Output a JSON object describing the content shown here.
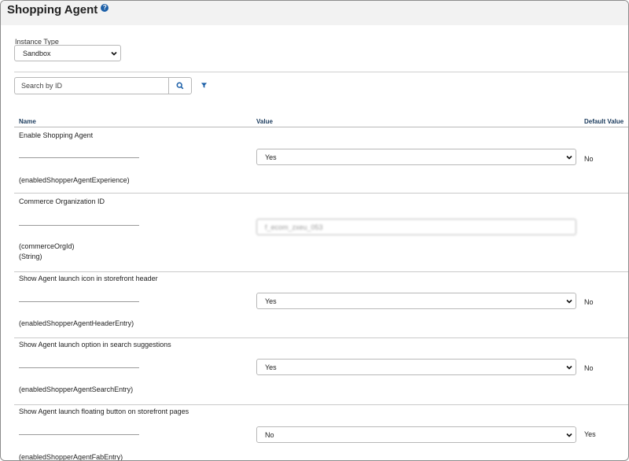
{
  "header": {
    "title": "Shopping Agent",
    "help_icon": "help-icon",
    "help_glyph": "?"
  },
  "instance": {
    "label": "Instance Type",
    "selected": "Sandbox"
  },
  "search": {
    "placeholder": "Search by ID",
    "search_icon": "search-icon",
    "filter_icon": "filter-icon"
  },
  "columns": {
    "name": "Name",
    "value": "Value",
    "default": "Default Value"
  },
  "preferences": [
    {
      "label": "Enable Shopping Agent",
      "id": "(enabledShopperAgentExperience)",
      "value": "Yes",
      "default": "No"
    },
    {
      "label": "Commerce Organization ID",
      "id": "(commerceOrgId)",
      "type": "(String)",
      "value": "f_ecom_zxeu_053",
      "default": ""
    },
    {
      "label": "Show Agent launch icon in storefront header",
      "id": "(enabledShopperAgentHeaderEntry)",
      "value": "Yes",
      "default": "No"
    },
    {
      "label": "Show Agent launch option in search suggestions",
      "id": "(enabledShopperAgentSearchEntry)",
      "value": "Yes",
      "default": "No"
    },
    {
      "label": "Show Agent launch floating button on storefront pages",
      "id": "(enabledShopperAgentFabEntry)",
      "value": "No",
      "default": "Yes"
    }
  ],
  "colors": {
    "accent": "#1b5fa8",
    "header_bg": "#f2f2f2",
    "column_header": "#1a3a5c"
  }
}
